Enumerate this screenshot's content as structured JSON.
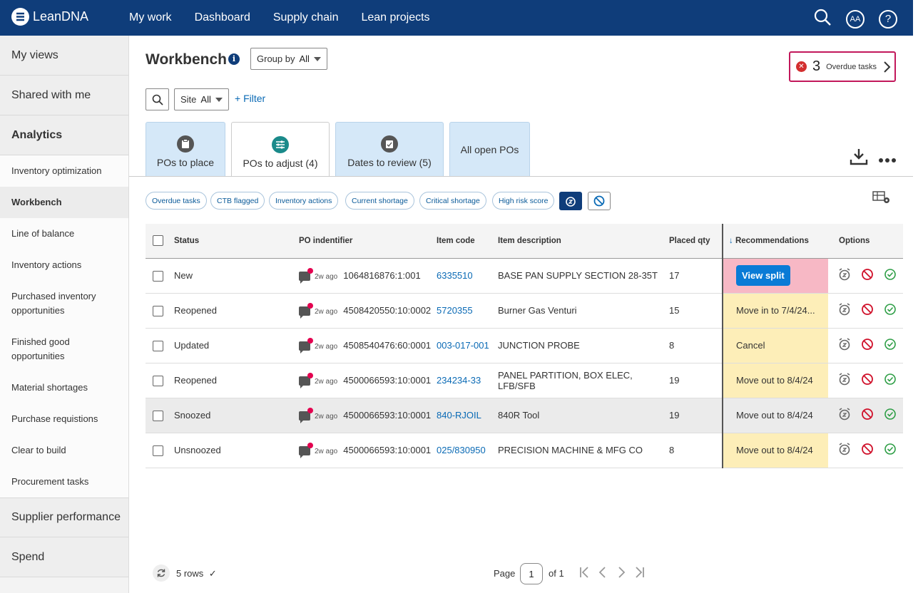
{
  "app": {
    "name": "LeanDNA"
  },
  "nav": {
    "items": [
      "My work",
      "Dashboard",
      "Supply chain",
      "Lean projects"
    ],
    "avatar": "AA"
  },
  "sidebar": {
    "sections": {
      "my_views": "My views",
      "shared": "Shared with me",
      "analytics": "Analytics",
      "supplier": "Supplier performance",
      "spend": "Spend"
    },
    "items": [
      "Inventory optimization",
      "Workbench",
      "Line of balance",
      "Inventory actions",
      "Purchased inventory opportunities",
      "Finished good opportunities",
      "Material shortages",
      "Purchase requistions",
      "Clear to build",
      "Procurement tasks"
    ]
  },
  "page": {
    "title": "Workbench",
    "group_label": "Group by",
    "group_value": "All",
    "site_label": "Site",
    "site_value": "All",
    "filter": "+ Filter"
  },
  "overdue": {
    "count": "3",
    "label": "Overdue tasks"
  },
  "tabs": [
    "POs to place",
    "POs to adjust (4)",
    "Dates to review (5)",
    "All open POs"
  ],
  "chips": [
    "Overdue tasks",
    "CTB flagged",
    "Inventory actions",
    "Current shortage",
    "Critical shortage",
    "High risk score"
  ],
  "table": {
    "headers": [
      "Status",
      "PO indentifier",
      "Item code",
      "Item description",
      "Placed qty",
      "Recommendations",
      "Options"
    ],
    "rows": [
      {
        "status": "New",
        "ago": "2w ago",
        "po": "1064816876:1:001",
        "code": "6335510",
        "desc": "BASE PAN SUPPLY SECTION 28-35T",
        "qty": "17",
        "rec": "View split"
      },
      {
        "status": "Reopened",
        "ago": "2w ago",
        "po": "4508420550:10:0002",
        "code": "5720355",
        "desc": "Burner Gas Venturi",
        "qty": "15",
        "rec": "Move in to 7/4/24..."
      },
      {
        "status": "Updated",
        "ago": "2w ago",
        "po": "4508540476:60:0001",
        "code": "003-017-001",
        "desc": "JUNCTION PROBE",
        "qty": "8",
        "rec": "Cancel"
      },
      {
        "status": "Reopened",
        "ago": "2w ago",
        "po": "4500066593:10:0001",
        "code": "234234-33",
        "desc": "PANEL PARTITION, BOX ELEC, LFB/SFB",
        "qty": "19",
        "rec": "Move out to 8/4/24"
      },
      {
        "status": "Snoozed",
        "ago": "2w ago",
        "po": "4500066593:10:0001",
        "code": "840-RJOIL",
        "desc": "840R Tool",
        "qty": "19",
        "rec": "Move out to 8/4/24"
      },
      {
        "status": "Unsnoozed",
        "ago": "2w ago",
        "po": "4500066593:10:0001",
        "code": "025/830950",
        "desc": "PRECISION MACHINE & MFG CO",
        "qty": "8",
        "rec": "Move out to 8/4/24"
      }
    ]
  },
  "footer": {
    "rows": "5 rows",
    "page_label": "Page",
    "page": "1",
    "of": "of 1"
  },
  "colors": {
    "brand": "#0f3d7a",
    "link": "#0a6ab5",
    "rec_bg": "#fdeeb8",
    "rec_alert": "#f7b8c5",
    "overdue": "#c2185b"
  }
}
